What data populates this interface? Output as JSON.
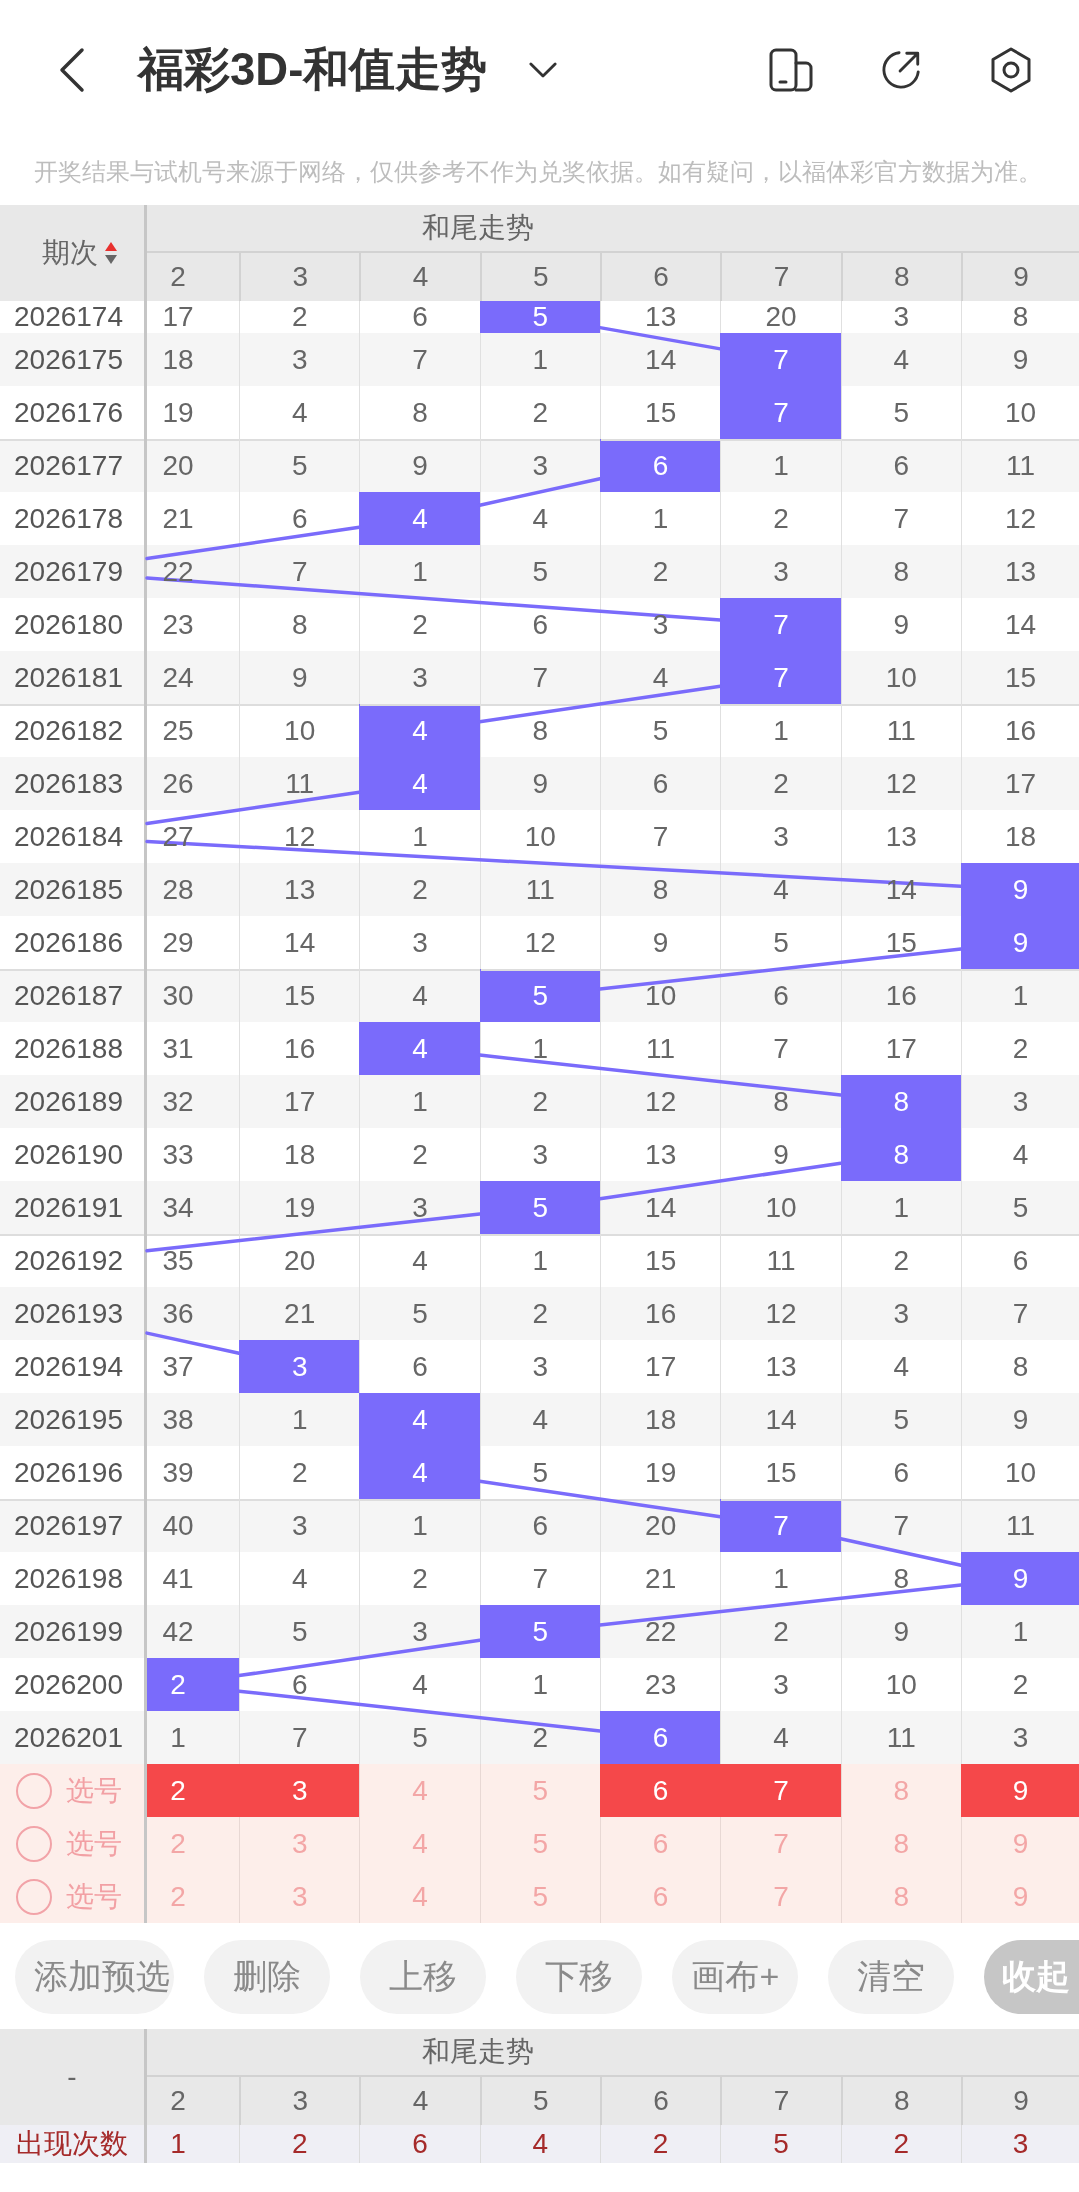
{
  "header": {
    "title": "福彩3D-和值走势"
  },
  "notice": "开奖结果与试机号来源于网络，仅供参考不作为兑奖依据。如有疑问，以福体彩官方数据为准。",
  "trend_table": {
    "period_header": "期次",
    "sort_ascending": true,
    "group_header": "和尾走势",
    "columns": [
      "2",
      "3",
      "4",
      "5",
      "6",
      "7",
      "8",
      "9"
    ],
    "rows": [
      {
        "period": "2026174",
        "cells": [
          {
            "text": "17",
            "hit": false
          },
          {
            "text": "2",
            "hit": false
          },
          {
            "text": "6",
            "hit": false
          },
          {
            "text": "5",
            "hit": true
          },
          {
            "text": "13",
            "hit": false
          },
          {
            "text": "20",
            "hit": false
          },
          {
            "text": "3",
            "hit": false
          },
          {
            "text": "8",
            "hit": false
          }
        ]
      },
      {
        "period": "2026175",
        "cells": [
          {
            "text": "18",
            "hit": false
          },
          {
            "text": "3",
            "hit": false
          },
          {
            "text": "7",
            "hit": false
          },
          {
            "text": "1",
            "hit": false
          },
          {
            "text": "14",
            "hit": false
          },
          {
            "text": "7",
            "hit": true
          },
          {
            "text": "4",
            "hit": false
          },
          {
            "text": "9",
            "hit": false
          }
        ]
      },
      {
        "period": "2026176",
        "cells": [
          {
            "text": "19",
            "hit": false
          },
          {
            "text": "4",
            "hit": false
          },
          {
            "text": "8",
            "hit": false
          },
          {
            "text": "2",
            "hit": false
          },
          {
            "text": "15",
            "hit": false
          },
          {
            "text": "7",
            "hit": true
          },
          {
            "text": "5",
            "hit": false
          },
          {
            "text": "10",
            "hit": false
          }
        ]
      },
      {
        "period": "2026177",
        "cells": [
          {
            "text": "20",
            "hit": false
          },
          {
            "text": "5",
            "hit": false
          },
          {
            "text": "9",
            "hit": false
          },
          {
            "text": "3",
            "hit": false
          },
          {
            "text": "6",
            "hit": true
          },
          {
            "text": "1",
            "hit": false
          },
          {
            "text": "6",
            "hit": false
          },
          {
            "text": "11",
            "hit": false
          }
        ]
      },
      {
        "period": "2026178",
        "cells": [
          {
            "text": "21",
            "hit": false
          },
          {
            "text": "6",
            "hit": false
          },
          {
            "text": "4",
            "hit": true
          },
          {
            "text": "4",
            "hit": false
          },
          {
            "text": "1",
            "hit": false
          },
          {
            "text": "2",
            "hit": false
          },
          {
            "text": "7",
            "hit": false
          },
          {
            "text": "12",
            "hit": false
          }
        ]
      },
      {
        "period": "2026179",
        "cells": [
          {
            "text": "22",
            "hit": false
          },
          {
            "text": "7",
            "hit": false
          },
          {
            "text": "1",
            "hit": false
          },
          {
            "text": "5",
            "hit": false
          },
          {
            "text": "2",
            "hit": false
          },
          {
            "text": "3",
            "hit": false
          },
          {
            "text": "8",
            "hit": false
          },
          {
            "text": "13",
            "hit": false
          }
        ]
      },
      {
        "period": "2026180",
        "cells": [
          {
            "text": "23",
            "hit": false
          },
          {
            "text": "8",
            "hit": false
          },
          {
            "text": "2",
            "hit": false
          },
          {
            "text": "6",
            "hit": false
          },
          {
            "text": "3",
            "hit": false
          },
          {
            "text": "7",
            "hit": true
          },
          {
            "text": "9",
            "hit": false
          },
          {
            "text": "14",
            "hit": false
          }
        ]
      },
      {
        "period": "2026181",
        "cells": [
          {
            "text": "24",
            "hit": false
          },
          {
            "text": "9",
            "hit": false
          },
          {
            "text": "3",
            "hit": false
          },
          {
            "text": "7",
            "hit": false
          },
          {
            "text": "4",
            "hit": false
          },
          {
            "text": "7",
            "hit": true
          },
          {
            "text": "10",
            "hit": false
          },
          {
            "text": "15",
            "hit": false
          }
        ]
      },
      {
        "period": "2026182",
        "cells": [
          {
            "text": "25",
            "hit": false
          },
          {
            "text": "10",
            "hit": false
          },
          {
            "text": "4",
            "hit": true
          },
          {
            "text": "8",
            "hit": false
          },
          {
            "text": "5",
            "hit": false
          },
          {
            "text": "1",
            "hit": false
          },
          {
            "text": "11",
            "hit": false
          },
          {
            "text": "16",
            "hit": false
          }
        ]
      },
      {
        "period": "2026183",
        "cells": [
          {
            "text": "26",
            "hit": false
          },
          {
            "text": "11",
            "hit": false
          },
          {
            "text": "4",
            "hit": true
          },
          {
            "text": "9",
            "hit": false
          },
          {
            "text": "6",
            "hit": false
          },
          {
            "text": "2",
            "hit": false
          },
          {
            "text": "12",
            "hit": false
          },
          {
            "text": "17",
            "hit": false
          }
        ]
      },
      {
        "period": "2026184",
        "cells": [
          {
            "text": "27",
            "hit": false
          },
          {
            "text": "12",
            "hit": false
          },
          {
            "text": "1",
            "hit": false
          },
          {
            "text": "10",
            "hit": false
          },
          {
            "text": "7",
            "hit": false
          },
          {
            "text": "3",
            "hit": false
          },
          {
            "text": "13",
            "hit": false
          },
          {
            "text": "18",
            "hit": false
          }
        ]
      },
      {
        "period": "2026185",
        "cells": [
          {
            "text": "28",
            "hit": false
          },
          {
            "text": "13",
            "hit": false
          },
          {
            "text": "2",
            "hit": false
          },
          {
            "text": "11",
            "hit": false
          },
          {
            "text": "8",
            "hit": false
          },
          {
            "text": "4",
            "hit": false
          },
          {
            "text": "14",
            "hit": false
          },
          {
            "text": "9",
            "hit": true
          }
        ]
      },
      {
        "period": "2026186",
        "cells": [
          {
            "text": "29",
            "hit": false
          },
          {
            "text": "14",
            "hit": false
          },
          {
            "text": "3",
            "hit": false
          },
          {
            "text": "12",
            "hit": false
          },
          {
            "text": "9",
            "hit": false
          },
          {
            "text": "5",
            "hit": false
          },
          {
            "text": "15",
            "hit": false
          },
          {
            "text": "9",
            "hit": true
          }
        ]
      },
      {
        "period": "2026187",
        "cells": [
          {
            "text": "30",
            "hit": false
          },
          {
            "text": "15",
            "hit": false
          },
          {
            "text": "4",
            "hit": false
          },
          {
            "text": "5",
            "hit": true
          },
          {
            "text": "10",
            "hit": false
          },
          {
            "text": "6",
            "hit": false
          },
          {
            "text": "16",
            "hit": false
          },
          {
            "text": "1",
            "hit": false
          }
        ]
      },
      {
        "period": "2026188",
        "cells": [
          {
            "text": "31",
            "hit": false
          },
          {
            "text": "16",
            "hit": false
          },
          {
            "text": "4",
            "hit": true
          },
          {
            "text": "1",
            "hit": false
          },
          {
            "text": "11",
            "hit": false
          },
          {
            "text": "7",
            "hit": false
          },
          {
            "text": "17",
            "hit": false
          },
          {
            "text": "2",
            "hit": false
          }
        ]
      },
      {
        "period": "2026189",
        "cells": [
          {
            "text": "32",
            "hit": false
          },
          {
            "text": "17",
            "hit": false
          },
          {
            "text": "1",
            "hit": false
          },
          {
            "text": "2",
            "hit": false
          },
          {
            "text": "12",
            "hit": false
          },
          {
            "text": "8",
            "hit": false
          },
          {
            "text": "8",
            "hit": true
          },
          {
            "text": "3",
            "hit": false
          }
        ]
      },
      {
        "period": "2026190",
        "cells": [
          {
            "text": "33",
            "hit": false
          },
          {
            "text": "18",
            "hit": false
          },
          {
            "text": "2",
            "hit": false
          },
          {
            "text": "3",
            "hit": false
          },
          {
            "text": "13",
            "hit": false
          },
          {
            "text": "9",
            "hit": false
          },
          {
            "text": "8",
            "hit": true
          },
          {
            "text": "4",
            "hit": false
          }
        ]
      },
      {
        "period": "2026191",
        "cells": [
          {
            "text": "34",
            "hit": false
          },
          {
            "text": "19",
            "hit": false
          },
          {
            "text": "3",
            "hit": false
          },
          {
            "text": "5",
            "hit": true
          },
          {
            "text": "14",
            "hit": false
          },
          {
            "text": "10",
            "hit": false
          },
          {
            "text": "1",
            "hit": false
          },
          {
            "text": "5",
            "hit": false
          }
        ]
      },
      {
        "period": "2026192",
        "cells": [
          {
            "text": "35",
            "hit": false
          },
          {
            "text": "20",
            "hit": false
          },
          {
            "text": "4",
            "hit": false
          },
          {
            "text": "1",
            "hit": false
          },
          {
            "text": "15",
            "hit": false
          },
          {
            "text": "11",
            "hit": false
          },
          {
            "text": "2",
            "hit": false
          },
          {
            "text": "6",
            "hit": false
          }
        ]
      },
      {
        "period": "2026193",
        "cells": [
          {
            "text": "36",
            "hit": false
          },
          {
            "text": "21",
            "hit": false
          },
          {
            "text": "5",
            "hit": false
          },
          {
            "text": "2",
            "hit": false
          },
          {
            "text": "16",
            "hit": false
          },
          {
            "text": "12",
            "hit": false
          },
          {
            "text": "3",
            "hit": false
          },
          {
            "text": "7",
            "hit": false
          }
        ]
      },
      {
        "period": "2026194",
        "cells": [
          {
            "text": "37",
            "hit": false
          },
          {
            "text": "3",
            "hit": true
          },
          {
            "text": "6",
            "hit": false
          },
          {
            "text": "3",
            "hit": false
          },
          {
            "text": "17",
            "hit": false
          },
          {
            "text": "13",
            "hit": false
          },
          {
            "text": "4",
            "hit": false
          },
          {
            "text": "8",
            "hit": false
          }
        ]
      },
      {
        "period": "2026195",
        "cells": [
          {
            "text": "38",
            "hit": false
          },
          {
            "text": "1",
            "hit": false
          },
          {
            "text": "4",
            "hit": true
          },
          {
            "text": "4",
            "hit": false
          },
          {
            "text": "18",
            "hit": false
          },
          {
            "text": "14",
            "hit": false
          },
          {
            "text": "5",
            "hit": false
          },
          {
            "text": "9",
            "hit": false
          }
        ]
      },
      {
        "period": "2026196",
        "cells": [
          {
            "text": "39",
            "hit": false
          },
          {
            "text": "2",
            "hit": false
          },
          {
            "text": "4",
            "hit": true
          },
          {
            "text": "5",
            "hit": false
          },
          {
            "text": "19",
            "hit": false
          },
          {
            "text": "15",
            "hit": false
          },
          {
            "text": "6",
            "hit": false
          },
          {
            "text": "10",
            "hit": false
          }
        ]
      },
      {
        "period": "2026197",
        "cells": [
          {
            "text": "40",
            "hit": false
          },
          {
            "text": "3",
            "hit": false
          },
          {
            "text": "1",
            "hit": false
          },
          {
            "text": "6",
            "hit": false
          },
          {
            "text": "20",
            "hit": false
          },
          {
            "text": "7",
            "hit": true
          },
          {
            "text": "7",
            "hit": false
          },
          {
            "text": "11",
            "hit": false
          }
        ]
      },
      {
        "period": "2026198",
        "cells": [
          {
            "text": "41",
            "hit": false
          },
          {
            "text": "4",
            "hit": false
          },
          {
            "text": "2",
            "hit": false
          },
          {
            "text": "7",
            "hit": false
          },
          {
            "text": "21",
            "hit": false
          },
          {
            "text": "1",
            "hit": false
          },
          {
            "text": "8",
            "hit": false
          },
          {
            "text": "9",
            "hit": true
          }
        ]
      },
      {
        "period": "2026199",
        "cells": [
          {
            "text": "42",
            "hit": false
          },
          {
            "text": "5",
            "hit": false
          },
          {
            "text": "3",
            "hit": false
          },
          {
            "text": "5",
            "hit": true
          },
          {
            "text": "22",
            "hit": false
          },
          {
            "text": "2",
            "hit": false
          },
          {
            "text": "9",
            "hit": false
          },
          {
            "text": "1",
            "hit": false
          }
        ]
      },
      {
        "period": "2026200",
        "cells": [
          {
            "text": "2",
            "hit": true
          },
          {
            "text": "6",
            "hit": false
          },
          {
            "text": "4",
            "hit": false
          },
          {
            "text": "1",
            "hit": false
          },
          {
            "text": "23",
            "hit": false
          },
          {
            "text": "3",
            "hit": false
          },
          {
            "text": "10",
            "hit": false
          },
          {
            "text": "2",
            "hit": false
          }
        ]
      },
      {
        "period": "2026201",
        "cells": [
          {
            "text": "1",
            "hit": false
          },
          {
            "text": "7",
            "hit": false
          },
          {
            "text": "5",
            "hit": false
          },
          {
            "text": "2",
            "hit": false
          },
          {
            "text": "6",
            "hit": true
          },
          {
            "text": "4",
            "hit": false
          },
          {
            "text": "11",
            "hit": false
          },
          {
            "text": "3",
            "hit": false
          }
        ]
      }
    ]
  },
  "pick_rows": [
    {
      "checked": false,
      "label": "选号",
      "cells": [
        {
          "text": "2",
          "selected": true
        },
        {
          "text": "3",
          "selected": true
        },
        {
          "text": "4",
          "selected": false
        },
        {
          "text": "5",
          "selected": false
        },
        {
          "text": "6",
          "selected": true
        },
        {
          "text": "7",
          "selected": true
        },
        {
          "text": "8",
          "selected": false
        },
        {
          "text": "9",
          "selected": true
        }
      ]
    },
    {
      "checked": false,
      "label": "选号",
      "cells": [
        {
          "text": "2",
          "selected": false
        },
        {
          "text": "3",
          "selected": false
        },
        {
          "text": "4",
          "selected": false
        },
        {
          "text": "5",
          "selected": false
        },
        {
          "text": "6",
          "selected": false
        },
        {
          "text": "7",
          "selected": false
        },
        {
          "text": "8",
          "selected": false
        },
        {
          "text": "9",
          "selected": false
        }
      ]
    },
    {
      "checked": false,
      "label": "选号",
      "cells": [
        {
          "text": "2",
          "selected": false
        },
        {
          "text": "3",
          "selected": false
        },
        {
          "text": "4",
          "selected": false
        },
        {
          "text": "5",
          "selected": false
        },
        {
          "text": "6",
          "selected": false
        },
        {
          "text": "7",
          "selected": false
        },
        {
          "text": "8",
          "selected": false
        },
        {
          "text": "9",
          "selected": false
        }
      ]
    }
  ],
  "buttons": [
    {
      "label": "添加预选",
      "kind": "plain"
    },
    {
      "label": "删除",
      "kind": "plain"
    },
    {
      "label": "上移",
      "kind": "plain"
    },
    {
      "label": "下移",
      "kind": "plain"
    },
    {
      "label": "画布+",
      "kind": "plain"
    },
    {
      "label": "清空",
      "kind": "plain"
    },
    {
      "label": "收起",
      "kind": "filled"
    }
  ],
  "stats_table": {
    "period_header": "-",
    "group_header": "和尾走势",
    "columns": [
      "2",
      "3",
      "4",
      "5",
      "6",
      "7",
      "8",
      "9"
    ],
    "rows": [
      {
        "label": "出现次数",
        "values": [
          "1",
          "2",
          "6",
          "4",
          "2",
          "5",
          "2",
          "3"
        ]
      }
    ]
  }
}
